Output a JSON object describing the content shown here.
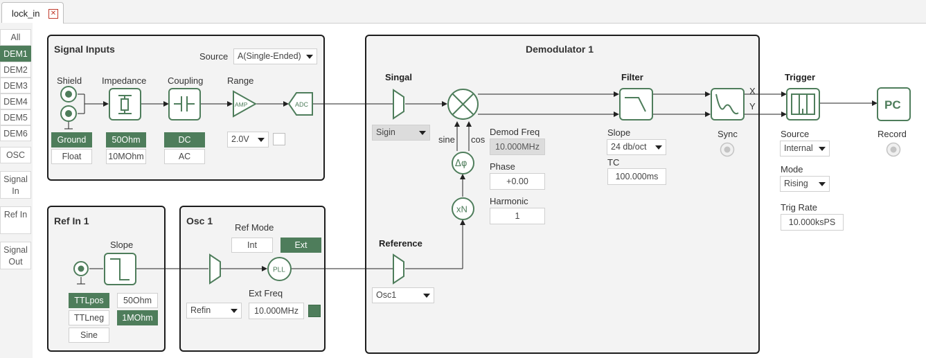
{
  "tab": {
    "title": "lock_in",
    "close_glyph": "✕"
  },
  "sidebar": {
    "items": [
      {
        "label": "All",
        "active": false
      },
      {
        "label": "DEM1",
        "active": true
      },
      {
        "label": "DEM2",
        "active": false
      },
      {
        "label": "DEM3",
        "active": false
      },
      {
        "label": "DEM4",
        "active": false
      },
      {
        "label": "DEM5",
        "active": false
      },
      {
        "label": "DEM6",
        "active": false
      },
      {
        "label": "OSC",
        "active": false
      },
      {
        "label": "Signal In",
        "active": false
      },
      {
        "label": "Ref In",
        "active": false
      },
      {
        "label": "Signal Out",
        "active": false
      }
    ]
  },
  "signal_inputs": {
    "title": "Signal Inputs",
    "source_label": "Source",
    "source_value": "A(Single-Ended)",
    "shield_label": "Shield",
    "impedance_label": "Impedance",
    "coupling_label": "Coupling",
    "range_label": "Range",
    "amp_text": "AMP",
    "adc_text": "ADC",
    "ground": "Ground",
    "float": "Float",
    "imp_50": "50Ohm",
    "imp_10m": "10MOhm",
    "dc": "DC",
    "ac": "AC",
    "range_value": "2.0V"
  },
  "ref_in": {
    "title": "Ref In 1",
    "slope_label": "Slope",
    "ttlpos": "TTLpos",
    "ttlneg": "TTLneg",
    "sine": "Sine",
    "imp_50": "50Ohm",
    "imp_1m": "1MOhm"
  },
  "osc": {
    "title": "Osc 1",
    "ref_mode_label": "Ref Mode",
    "int": "Int",
    "ext": "Ext",
    "pll_text": "PLL",
    "source_value": "Refin",
    "ext_freq_label": "Ext Freq",
    "ext_freq_value": "10.000MHz"
  },
  "demod": {
    "title": "Demodulator 1",
    "signal_label": "Singal",
    "signal_value": "Sigin",
    "reference_label": "Reference",
    "reference_value": "Osc1",
    "sine_label": "sine",
    "cos_label": "cos",
    "phase_shift_text": "Δφ",
    "harmonic_mult_text": "xN",
    "demod_freq_label": "Demod Freq",
    "demod_freq_value": "10.000MHz",
    "phase_label": "Phase",
    "phase_value": "+0.00",
    "harmonic_label": "Harmonic",
    "harmonic_value": "1",
    "filter_label": "Filter",
    "slope_label": "Slope",
    "slope_value": "24 db/oct",
    "tc_label": "TC",
    "tc_value": "100.000ms",
    "sync_label": "Sync",
    "x_label": "X",
    "y_label": "Y"
  },
  "trigger": {
    "title": "Trigger",
    "source_label": "Source",
    "source_value": "Internal",
    "mode_label": "Mode",
    "mode_value": "Rising",
    "rate_label": "Trig Rate",
    "rate_value": "10.000ksPS"
  },
  "record": {
    "pc_text": "PC",
    "label": "Record"
  },
  "colors": {
    "accent": "#4e7d5b",
    "panel_bg": "#f3f3f3",
    "border": "#1c1c1c"
  }
}
